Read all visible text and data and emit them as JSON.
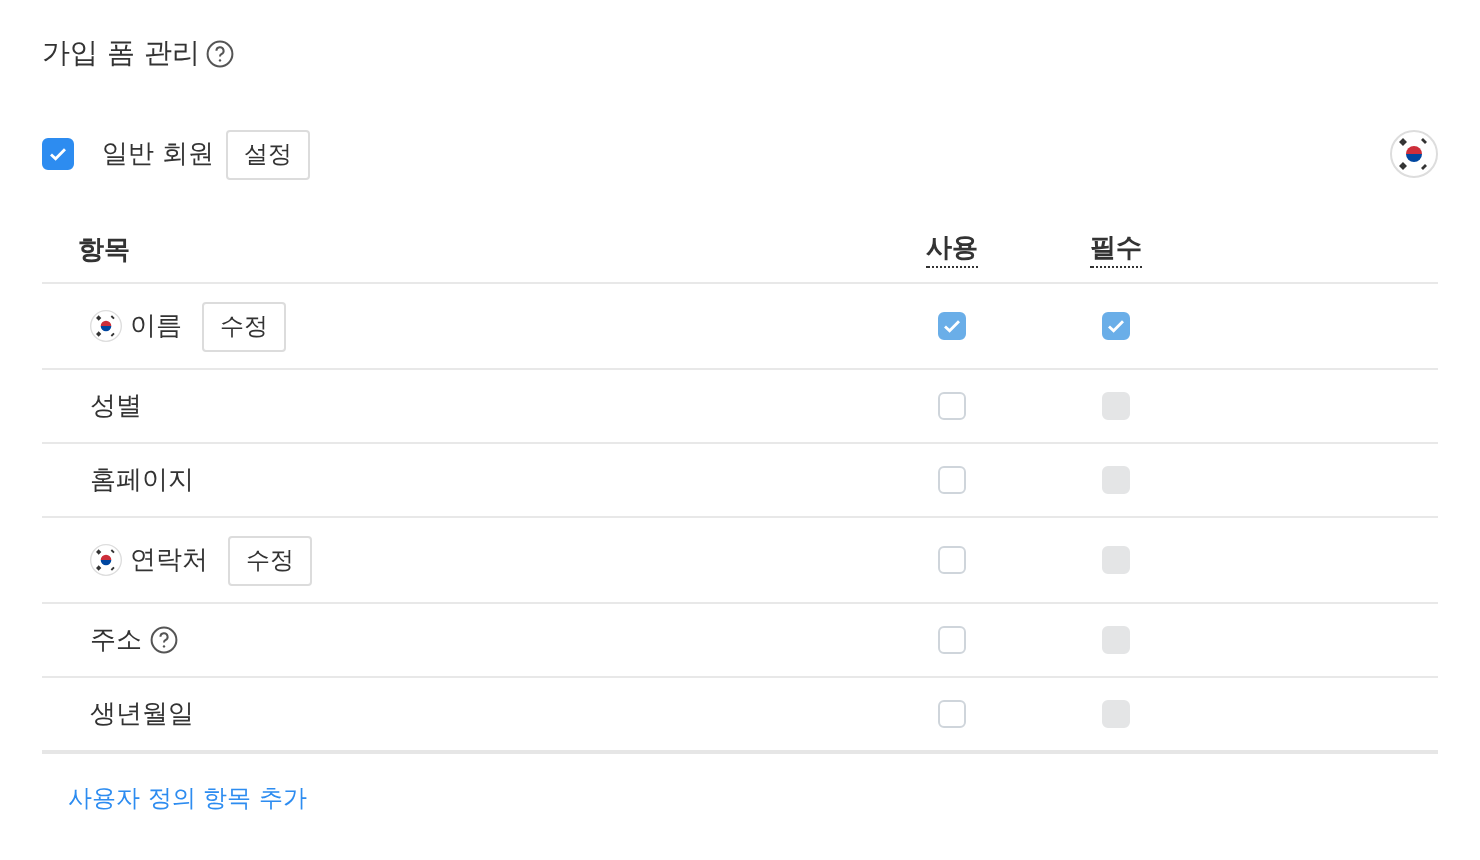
{
  "title": {
    "text": "가입 폼 관리",
    "kind": "help"
  },
  "member": {
    "label": "일반 회원",
    "checked": true,
    "button": "설정"
  },
  "columns": [
    "항목",
    "사용",
    "필수"
  ],
  "rows": [
    {
      "kind": "flag",
      "label": "이름",
      "button": "수정",
      "use": {
        "checked": true,
        "disabled": true
      },
      "required": {
        "checked": true,
        "disabled": true
      }
    },
    {
      "kind": "plain",
      "label": "성별",
      "use": {
        "checked": false,
        "disabled": false
      },
      "required": {
        "checked": false,
        "disabled": true
      }
    },
    {
      "kind": "plain",
      "label": "홈페이지",
      "use": {
        "checked": false,
        "disabled": false
      },
      "required": {
        "checked": false,
        "disabled": true
      }
    },
    {
      "kind": "flag",
      "label": "연락처",
      "button": "수정",
      "use": {
        "checked": false,
        "disabled": false
      },
      "required": {
        "checked": false,
        "disabled": true
      }
    },
    {
      "kind": "help",
      "label": "주소",
      "use": {
        "checked": false,
        "disabled": false
      },
      "required": {
        "checked": false,
        "disabled": true
      }
    },
    {
      "kind": "plain",
      "label": "생년월일",
      "use": {
        "checked": false,
        "disabled": false
      },
      "required": {
        "checked": false,
        "disabled": true
      }
    }
  ],
  "add_link": "사용자 정의 항목 추가"
}
